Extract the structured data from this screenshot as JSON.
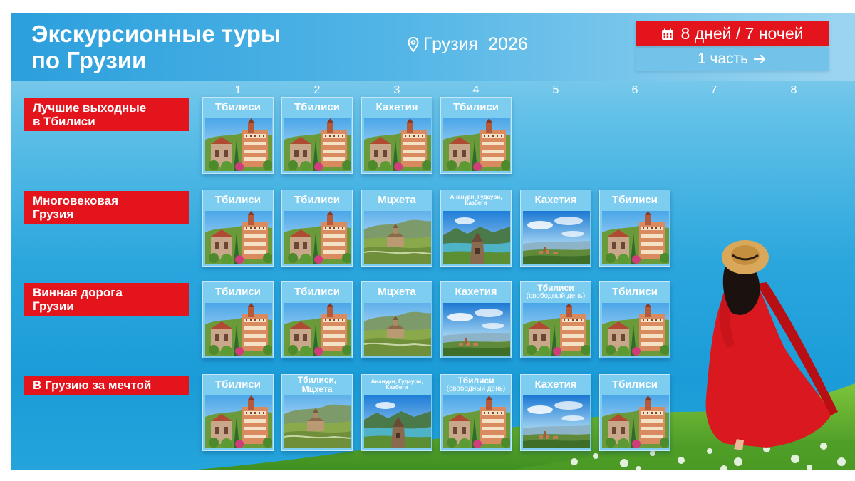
{
  "header": {
    "title_line1": "Экскурсионные туры",
    "title_line2": "по Грузии",
    "location": "Грузия  2026",
    "duration": "8 дней / 7 ночей",
    "part": "1 часть"
  },
  "day_numbers": [
    "1",
    "2",
    "3",
    "4",
    "5",
    "6",
    "7",
    "8"
  ],
  "tours": [
    {
      "name_line1": "Лучшие выходные",
      "name_line2": "в Тбилиси",
      "days": [
        {
          "title": "Тбилиси",
          "photo": "tbilisi-old-town"
        },
        {
          "title": "Тбилиси",
          "photo": "tbilisi-old-town"
        },
        {
          "title": "Кахетия",
          "photo": "tbilisi-old-town"
        },
        {
          "title": "Тбилиси",
          "photo": "tbilisi-old-town"
        }
      ]
    },
    {
      "name_line1": "Многовековая",
      "name_line2": "Грузия",
      "days": [
        {
          "title": "Тбилиси",
          "photo": "tbilisi-old-town"
        },
        {
          "title": "Тбилиси",
          "photo": "tbilisi-old-town"
        },
        {
          "title": "Мцхета",
          "photo": "mtskheta-monastery"
        },
        {
          "title": "Ананури, Гудаури, Казбеги",
          "photo": "ananuri-fortress"
        },
        {
          "title": "Кахетия",
          "photo": "kakheti-valley"
        },
        {
          "title": "Тбилиси",
          "photo": "tbilisi-old-town"
        }
      ]
    },
    {
      "name_line1": "Винная дорога",
      "name_line2": "Грузии",
      "days": [
        {
          "title": "Тбилиси",
          "photo": "tbilisi-old-town"
        },
        {
          "title": "Тбилиси",
          "photo": "tbilisi-old-town"
        },
        {
          "title": "Мцхета",
          "photo": "mtskheta-monastery"
        },
        {
          "title": "Кахетия",
          "photo": "kakheti-valley"
        },
        {
          "title": "Тбилиси",
          "subtitle": "(свободный день)",
          "photo": "tbilisi-old-town"
        },
        {
          "title": "Тбилиси",
          "photo": "tbilisi-old-town"
        }
      ]
    },
    {
      "name_line1": "В Грузию за мечтой",
      "name_line2": "",
      "days": [
        {
          "title": "Тбилиси",
          "photo": "tbilisi-old-town"
        },
        {
          "title": "Тбилиси, Мцхета",
          "photo": "mtskheta-monastery"
        },
        {
          "title": "Ананури, Гудаури, Казбеги",
          "photo": "ananuri-fortress"
        },
        {
          "title": "Тбилиси",
          "subtitle": "(свободный день)",
          "photo": "tbilisi-old-town"
        },
        {
          "title": "Кахетия",
          "photo": "kakheti-valley"
        },
        {
          "title": "Тбилиси",
          "photo": "tbilisi-old-town"
        }
      ]
    }
  ],
  "icons": {
    "location": "map-pin-icon",
    "duration": "calendar-icon",
    "part": "arrow-right-icon"
  },
  "colors": {
    "accent_red": "#e3141c",
    "sky_blue": "#1b9cd8",
    "card_blue": "#7dcdf1",
    "dress_red": "#d9191f",
    "grass_green": "#5fae2e"
  }
}
